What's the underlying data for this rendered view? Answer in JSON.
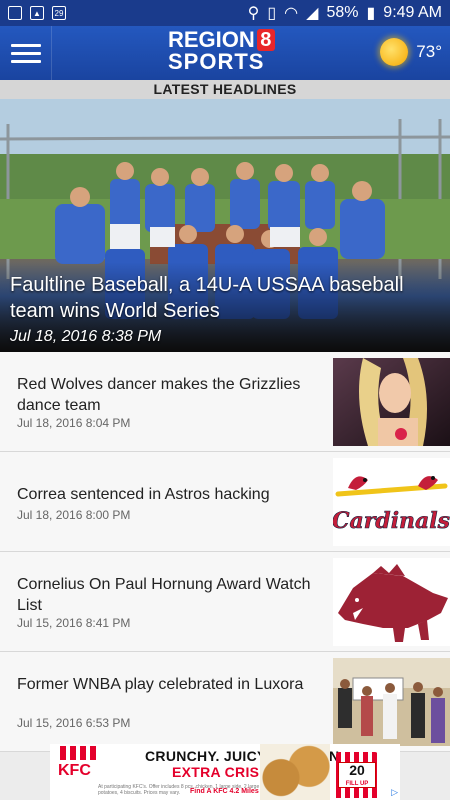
{
  "status_bar": {
    "left_icons": [
      "notification-icon",
      "image-icon",
      "calendar-icon"
    ],
    "calendar_day": "29",
    "battery": "58%",
    "time": "9:49 AM"
  },
  "header": {
    "logo_line1": "REGION",
    "logo_number": "8",
    "logo_line2": "SPORTS",
    "temperature": "73°"
  },
  "section_title": "LATEST HEADLINES",
  "hero": {
    "title": "Faultline Baseball, a 14U-A USSAA baseball team wins World Series",
    "date": "Jul 18, 2016 8:38 PM"
  },
  "articles": [
    {
      "title": "Red Wolves dancer makes the Grizzlies dance team",
      "date": "Jul 18, 2016 8:04 PM",
      "thumb": "dancer-photo"
    },
    {
      "title": "Correa sentenced in Astros hacking",
      "date": "Jul 18, 2016 8:00 PM",
      "thumb": "cardinals-logo"
    },
    {
      "title": "Cornelius On Paul Hornung Award Watch List",
      "date": "Jul 15, 2016 8:41 PM",
      "thumb": "razorback-logo"
    },
    {
      "title": "Former WNBA play celebrated in Luxora",
      "date": "Jul 15, 2016 6:53 PM",
      "thumb": "event-photo"
    }
  ],
  "thumb_text": {
    "cardinals": "Cardinals"
  },
  "ad": {
    "brand": "KFC",
    "headline1": "CRUNCHY. JUICY. CHICKEN.",
    "headline2": "EXTRA CRISPY.™",
    "fine_print": "At participating KFC's. Offer includes 8 pcs. chicken, 1 large side, 2 large mashed potatoes, 4 biscuits. Prices may vary.",
    "cta": "Find A KFC 4.2 Miles Away",
    "bucket_number": "20",
    "bucket_text": "FILL UP"
  },
  "colors": {
    "status_bar": "#1a3b8c",
    "app_bar": "#1f4fae",
    "accent_red": "#e8262a",
    "headline_bar": "#d6d6d6"
  }
}
